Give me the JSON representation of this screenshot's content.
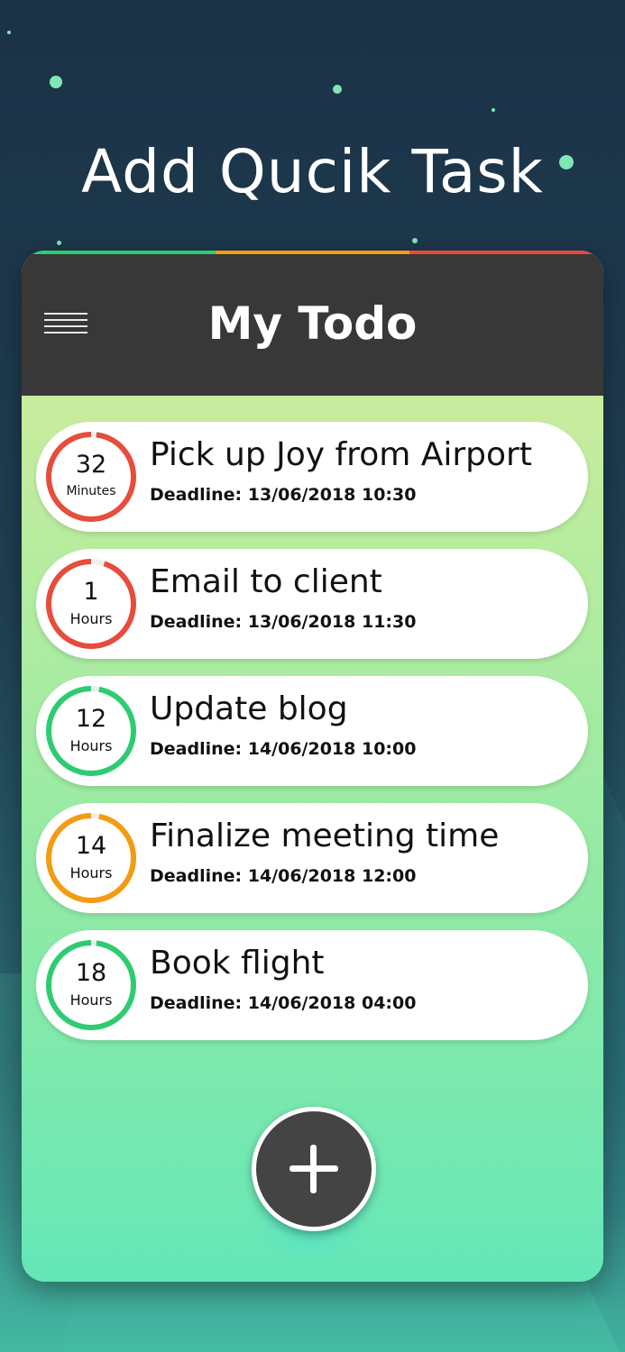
{
  "promo": {
    "title": "Add Qucik Task"
  },
  "app": {
    "title": "My Todo",
    "menu_icon": "hamburger-menu-icon",
    "top_bar_colors": [
      "#2ecc71",
      "#f39c12",
      "#e74c3c"
    ]
  },
  "tasks": [
    {
      "title": "Pick up Joy from Airport",
      "deadline": "Deadline: 13/06/2018 10:30",
      "remaining_value": "32",
      "remaining_unit": "Minutes",
      "ring_color": "#e74c3c",
      "progress": 0.98
    },
    {
      "title": "Email to client",
      "deadline": "Deadline: 13/06/2018 11:30",
      "remaining_value": "1",
      "remaining_unit": "Hours",
      "ring_color": "#e74c3c",
      "progress": 0.95
    },
    {
      "title": "Update blog",
      "deadline": "Deadline: 14/06/2018 10:00",
      "remaining_value": "12",
      "remaining_unit": "Hours",
      "ring_color": "#2ecc71",
      "progress": 0.97
    },
    {
      "title": "Finalize meeting time",
      "deadline": "Deadline: 14/06/2018 12:00",
      "remaining_value": "14",
      "remaining_unit": "Hours",
      "ring_color": "#f39c12",
      "progress": 0.97
    },
    {
      "title": "Book flight",
      "deadline": "Deadline: 14/06/2018 04:00",
      "remaining_value": "18",
      "remaining_unit": "Hours",
      "ring_color": "#2ecc71",
      "progress": 0.98
    }
  ],
  "fab": {
    "icon": "plus-icon"
  }
}
